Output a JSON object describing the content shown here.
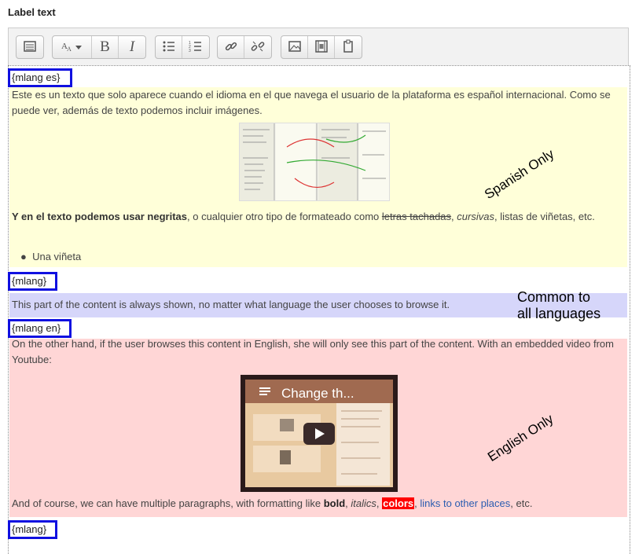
{
  "label": "Label text",
  "toolbar": {
    "groups": [
      [
        "toolbar-toggle"
      ],
      [
        "font-style",
        "bold",
        "italic"
      ],
      [
        "bulleted-list",
        "numbered-list"
      ],
      [
        "link",
        "unlink"
      ],
      [
        "image",
        "media",
        "paste"
      ]
    ],
    "bold_glyph": "B",
    "italic_glyph": "I"
  },
  "editor": {
    "tag_es": "{mlang es}",
    "tag_close_1": "{mlang}",
    "tag_en": "{mlang en}",
    "tag_close_2": "{mlang}",
    "es_para1": "Este es un texto que solo aparece cuando el idioma en el que navega el usuario de la plataforma es español internacional. Como se puede ver, además de texto podemos incluir imágenes.",
    "es_bold": "Y en el texto podemos usar negritas",
    "es_mid": ", o cualquier otro tipo de formateado como ",
    "es_strike": "letras tachadas",
    "es_comma": ", ",
    "es_italic": "cursivas",
    "es_end": ", listas de viñetas, etc.",
    "es_bullet": "Una viñeta",
    "common_text": "This part of the content is always shown, no matter what language the user chooses to browse it.",
    "en_para1": "On the other hand, if the user browses this content in English, she will only see this part of the content. With an embedded video from Youtube:",
    "video_title": "Change th...",
    "en_p2_start": "And of course, we can have multiple paragraphs, with formatting like ",
    "en_bold": "bold",
    "en_comma": ", ",
    "en_italic": "italics",
    "en_comma2": ", ",
    "en_colors": "colors",
    "en_comma3": ", ",
    "en_link": "links to other places",
    "en_end": ", etc."
  },
  "annotations": {
    "spanish_only": "Spanish Only",
    "common_line1": "Common to",
    "common_line2": "all languages",
    "english_only": "English Only"
  },
  "colors": {
    "tag_border": "#1010e0",
    "es_bg": "#ffffd9",
    "common_bg": "#d6d6fa",
    "en_bg": "#ffd6d6",
    "colors_bg": "#ff0000",
    "link": "#2a5db0"
  }
}
